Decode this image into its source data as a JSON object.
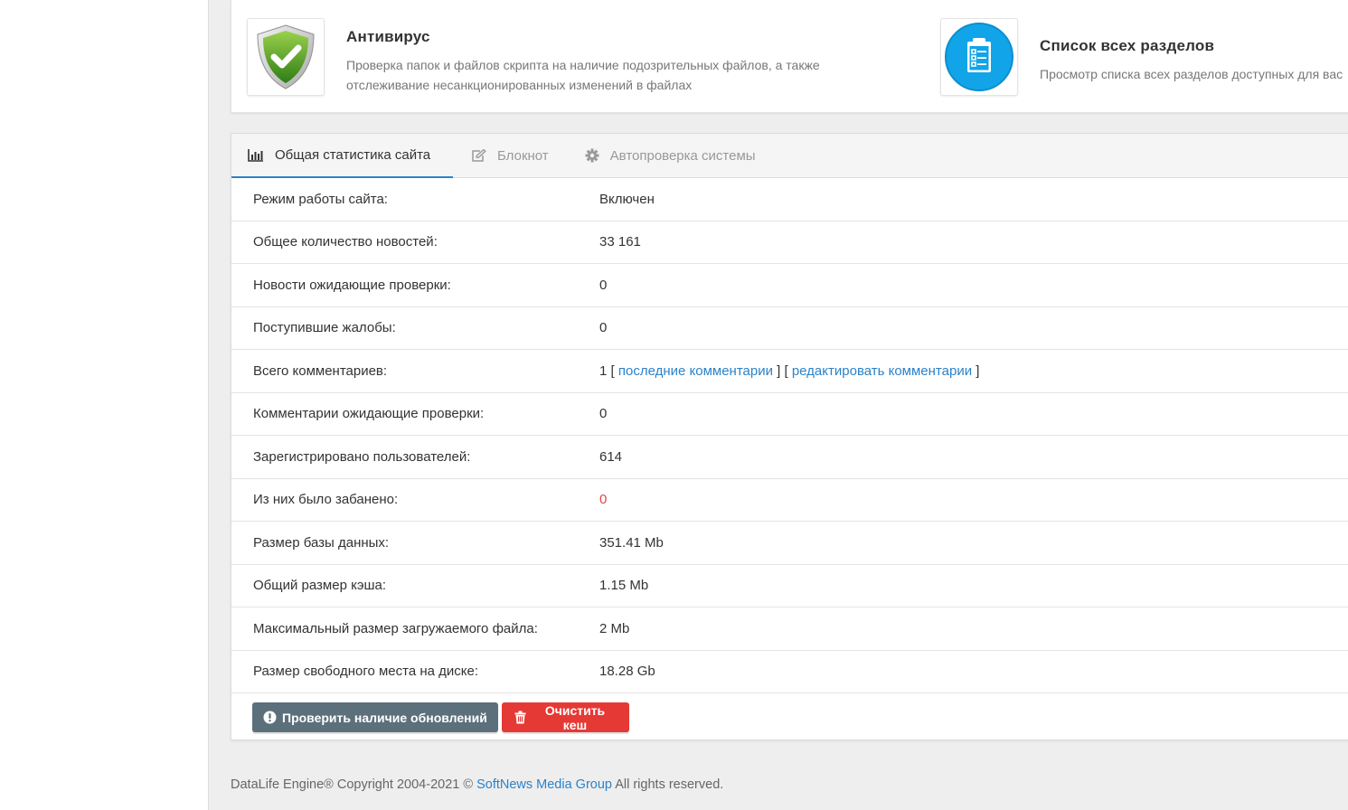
{
  "shortcuts": [
    {
      "icon": "shield-check-icon",
      "title": "Антивирус",
      "description": "Проверка папок и файлов скрипта на наличие подозрительных файлов, а также отслеживание несанкционированных изменений в файлах"
    },
    {
      "icon": "clipboard-list-icon",
      "title": "Список всех разделов",
      "description": "Просмотр списка всех разделов доступных для вас"
    }
  ],
  "tabs": [
    {
      "label": "Общая статистика сайта",
      "icon": "bar-chart-icon",
      "active": true
    },
    {
      "label": "Блокнот",
      "icon": "edit-icon",
      "active": false
    },
    {
      "label": "Автопроверка системы",
      "icon": "gear-icon",
      "active": false
    }
  ],
  "stats": {
    "mode": {
      "label": "Режим работы сайта:",
      "value": "Включен"
    },
    "news_total": {
      "label": "Общее количество новостей:",
      "value": "33 161"
    },
    "news_pending": {
      "label": "Новости ожидающие проверки:",
      "value": "0"
    },
    "complaints": {
      "label": "Поступившие жалобы:",
      "value": "0"
    },
    "comments_total": {
      "label": "Всего комментариев:",
      "value": "1",
      "bracket_open": " [ ",
      "link_last": "последние комментарии",
      "bracket_mid": " ] [ ",
      "link_edit": "редактировать комментарии",
      "bracket_close": " ]"
    },
    "comments_pending": {
      "label": "Комментарии ожидающие проверки:",
      "value": "0"
    },
    "users": {
      "label": "Зарегистрировано пользователей:",
      "value": "614"
    },
    "banned": {
      "label": "Из них было забанено:",
      "value": "0"
    },
    "db_size": {
      "label": "Размер базы данных:",
      "value": "351.41 Mb"
    },
    "cache_size": {
      "label": "Общий размер кэша:",
      "value": "1.15 Mb"
    },
    "max_upload": {
      "label": "Максимальный размер загружаемого файла:",
      "value": "2 Mb"
    },
    "disk_free": {
      "label": "Размер свободного места на диске:",
      "value": "18.28 Gb"
    }
  },
  "buttons": {
    "check_updates": "Проверить наличие обновлений",
    "clear_cache": "Очистить кеш"
  },
  "footer": {
    "prefix": "DataLife Engine® Copyright 2004-2021 © ",
    "link": "SoftNews Media Group",
    "suffix": " All rights reserved."
  },
  "colors": {
    "accent": "#2c82c9",
    "danger": "#e53935",
    "update_button": "#5c707c",
    "banned_value": "#e04646"
  }
}
